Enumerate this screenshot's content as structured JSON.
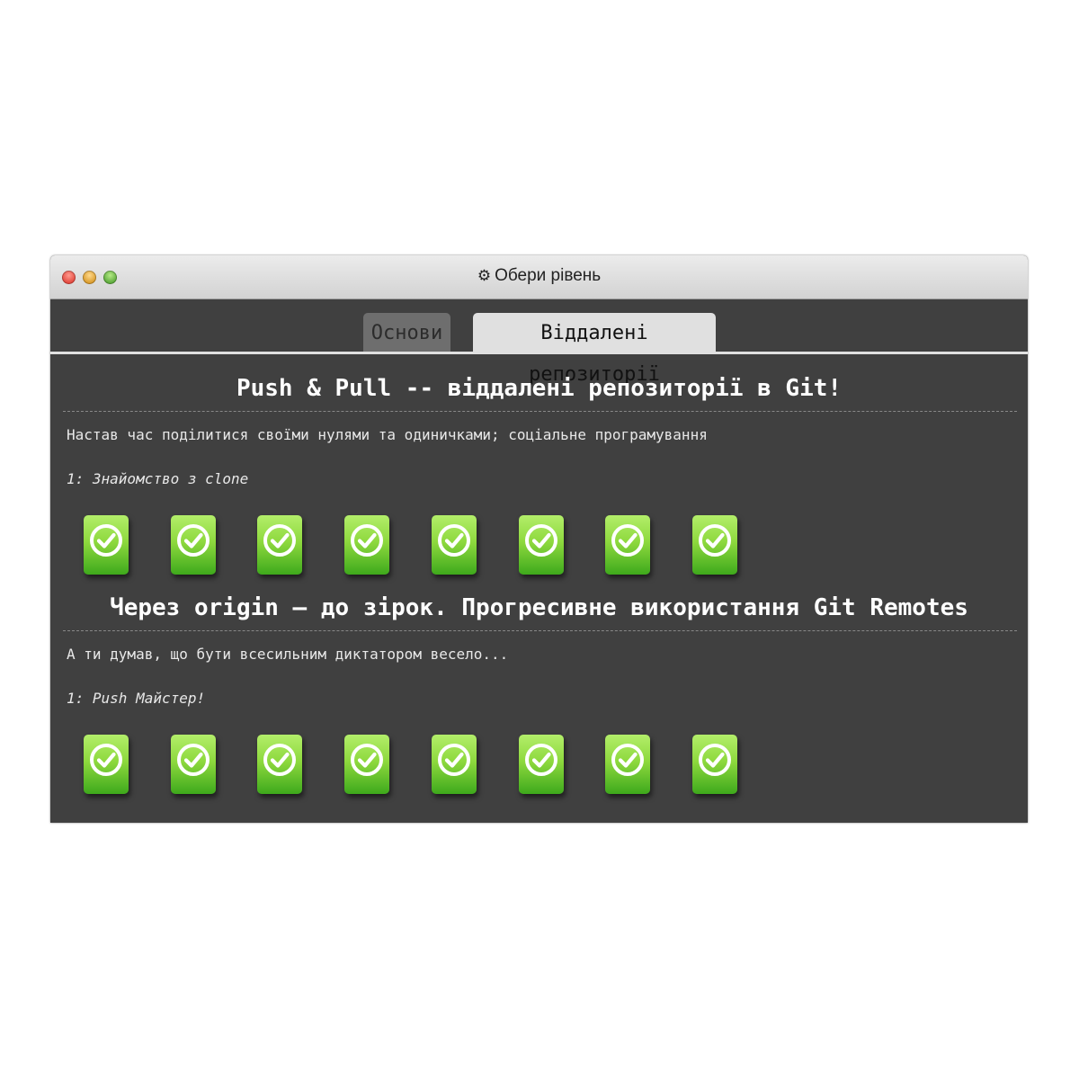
{
  "window": {
    "title": "Обери рівень",
    "title_icon": "gear-icon"
  },
  "tabs": [
    {
      "label": "Основи",
      "active": false
    },
    {
      "label": "Віддалені репозиторії",
      "active": true
    }
  ],
  "sections": [
    {
      "title": "Push & Pull -- віддалені репозиторії в Git!",
      "description": "Настав час поділитися своїми нулями та одиничками; соціальне програмування",
      "selected_level": "1: Знайомство з clone",
      "levels": [
        {
          "status": "complete"
        },
        {
          "status": "complete"
        },
        {
          "status": "complete"
        },
        {
          "status": "complete"
        },
        {
          "status": "complete"
        },
        {
          "status": "complete"
        },
        {
          "status": "complete"
        },
        {
          "status": "complete"
        }
      ]
    },
    {
      "title": "Через origin — до зірок. Прогресивне використання Git Remotes",
      "description": "А ти думав, що бути всесильним диктатором весело...",
      "selected_level": "1: Push Майстер!",
      "levels": [
        {
          "status": "complete"
        },
        {
          "status": "complete"
        },
        {
          "status": "complete"
        },
        {
          "status": "complete"
        },
        {
          "status": "complete"
        },
        {
          "status": "complete"
        },
        {
          "status": "complete"
        },
        {
          "status": "complete"
        }
      ]
    }
  ],
  "colors": {
    "background": "#404040",
    "level_complete": "#8ed93e",
    "active_tab": "#e0e0e0"
  }
}
